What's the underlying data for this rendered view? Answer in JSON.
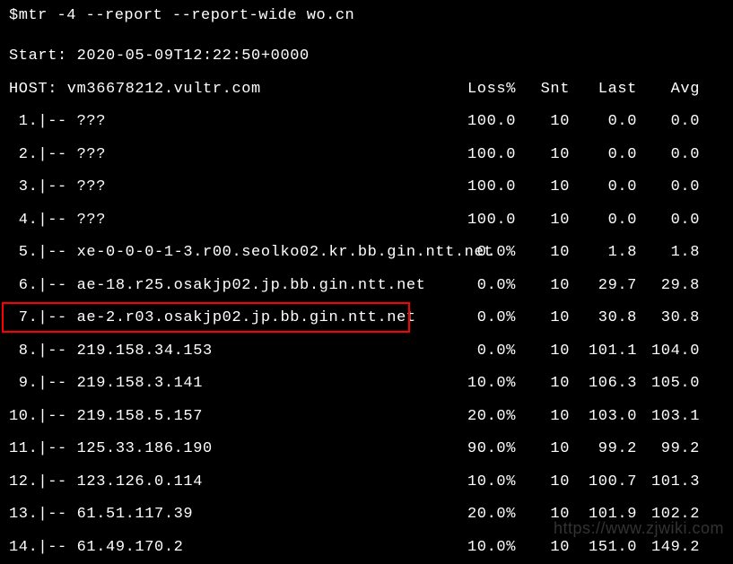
{
  "command": "$mtr -4 --report --report-wide wo.cn",
  "start_line": "Start: 2020-05-09T12:22:50+0000",
  "header": {
    "host_label": "HOST: vm36678212.vultr.com",
    "loss": "Loss%",
    "snt": "Snt",
    "last": "Last",
    "avg": "Avg"
  },
  "hops": [
    {
      "n": "1.",
      "host": "???",
      "loss": "100.0",
      "snt": "10",
      "last": "0.0",
      "avg": "0.0"
    },
    {
      "n": "2.",
      "host": "???",
      "loss": "100.0",
      "snt": "10",
      "last": "0.0",
      "avg": "0.0"
    },
    {
      "n": "3.",
      "host": "???",
      "loss": "100.0",
      "snt": "10",
      "last": "0.0",
      "avg": "0.0"
    },
    {
      "n": "4.",
      "host": "???",
      "loss": "100.0",
      "snt": "10",
      "last": "0.0",
      "avg": "0.0"
    },
    {
      "n": "5.",
      "host": "xe-0-0-0-1-3.r00.seolko02.kr.bb.gin.ntt.net",
      "loss": "0.0%",
      "snt": "10",
      "last": "1.8",
      "avg": "1.8"
    },
    {
      "n": "6.",
      "host": "ae-18.r25.osakjp02.jp.bb.gin.ntt.net",
      "loss": "0.0%",
      "snt": "10",
      "last": "29.7",
      "avg": "29.8"
    },
    {
      "n": "7.",
      "host": "ae-2.r03.osakjp02.jp.bb.gin.ntt.net",
      "loss": "0.0%",
      "snt": "10",
      "last": "30.8",
      "avg": "30.8"
    },
    {
      "n": "8.",
      "host": "219.158.34.153",
      "loss": "0.0%",
      "snt": "10",
      "last": "101.1",
      "avg": "104.0"
    },
    {
      "n": "9.",
      "host": "219.158.3.141",
      "loss": "10.0%",
      "snt": "10",
      "last": "106.3",
      "avg": "105.0"
    },
    {
      "n": "10.",
      "host": "219.158.5.157",
      "loss": "20.0%",
      "snt": "10",
      "last": "103.0",
      "avg": "103.1"
    },
    {
      "n": "11.",
      "host": "125.33.186.190",
      "loss": "90.0%",
      "snt": "10",
      "last": "99.2",
      "avg": "99.2"
    },
    {
      "n": "12.",
      "host": "123.126.0.114",
      "loss": "10.0%",
      "snt": "10",
      "last": "100.7",
      "avg": "101.3"
    },
    {
      "n": "13.",
      "host": "61.51.117.39",
      "loss": "20.0%",
      "snt": "10",
      "last": "101.9",
      "avg": "102.2"
    },
    {
      "n": "14.",
      "host": "61.49.170.2",
      "loss": "10.0%",
      "snt": "10",
      "last": "151.0",
      "avg": "149.2"
    }
  ],
  "highlight_index": 6,
  "watermark": "https://www.zjwiki.com"
}
